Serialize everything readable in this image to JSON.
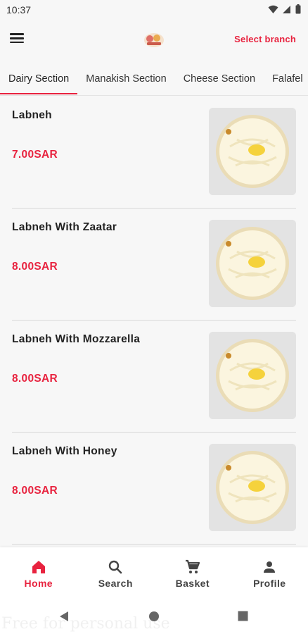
{
  "status_bar": {
    "time": "10:37"
  },
  "app_bar": {
    "select_branch_label": "Select branch"
  },
  "tabs": [
    {
      "label": "Dairy Section"
    },
    {
      "label": "Manakish Section"
    },
    {
      "label": "Cheese Section"
    },
    {
      "label": "Falafel"
    }
  ],
  "items": [
    {
      "name": "Labneh",
      "price": "7.00SAR"
    },
    {
      "name": "Labneh With Zaatar",
      "price": "8.00SAR"
    },
    {
      "name": "Labneh With Mozzarella",
      "price": "8.00SAR"
    },
    {
      "name": "Labneh With Honey",
      "price": "8.00SAR"
    }
  ],
  "bottom_nav": [
    {
      "label": "Home",
      "icon": "home-icon"
    },
    {
      "label": "Search",
      "icon": "search-icon"
    },
    {
      "label": "Basket",
      "icon": "cart-icon"
    },
    {
      "label": "Profile",
      "icon": "person-icon"
    }
  ],
  "watermark": "Free for personal use",
  "colors": {
    "accent": "#e8233f",
    "background": "#f7f7f7",
    "text": "#222222"
  }
}
